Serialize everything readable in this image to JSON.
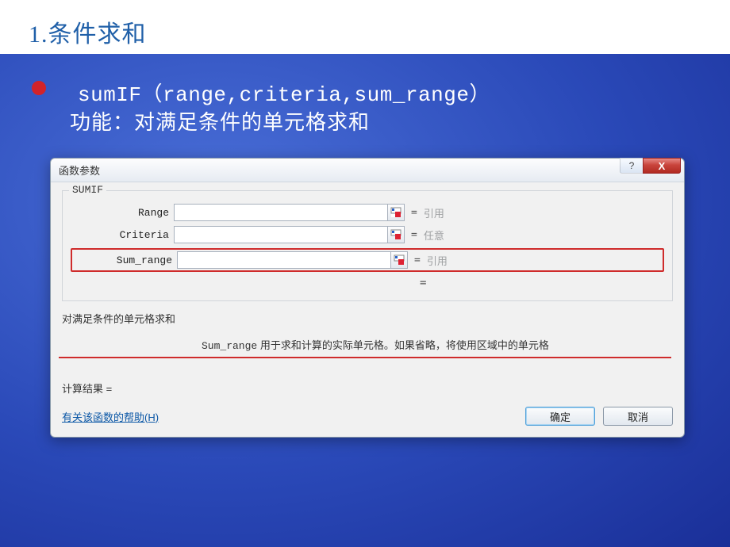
{
  "slide": {
    "heading": "1.条件求和",
    "formula": "sumIF（range,criteria,sum_range）",
    "description": "功能：对满足条件的单元格求和"
  },
  "dialog": {
    "title": "函数参数",
    "help_glyph": "?",
    "close_glyph": "X",
    "group_label": "SUMIF",
    "params": {
      "range": {
        "label": "Range",
        "hint": "引用"
      },
      "criteria": {
        "label": "Criteria",
        "hint": "任意"
      },
      "sum_range": {
        "label": "Sum_range",
        "hint": "引用"
      }
    },
    "equals": "=",
    "desc_main": "对满足条件的单元格求和",
    "desc_param_name": "Sum_range",
    "desc_param_text": " 用于求和计算的实际单元格。如果省略，将使用区域中的单元格",
    "result_label": "计算结果 =",
    "help_link": "有关该函数的帮助(H)",
    "ok_label": "确定",
    "cancel_label": "取消"
  }
}
